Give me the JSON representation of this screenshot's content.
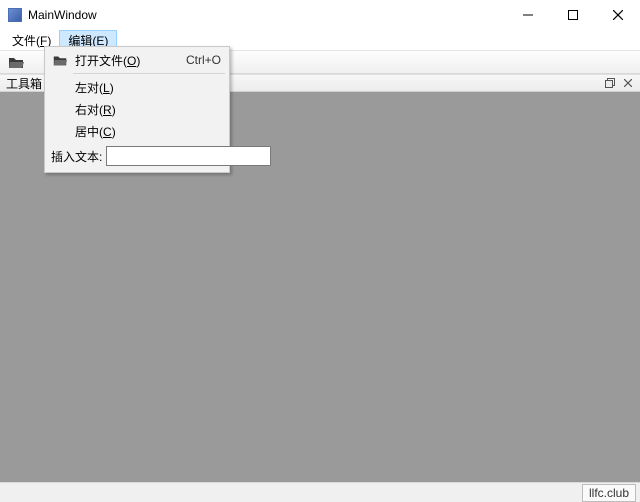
{
  "window": {
    "title": "MainWindow"
  },
  "menubar": {
    "file": {
      "label": "文件",
      "mnemonic": "F"
    },
    "edit": {
      "label": "编辑",
      "mnemonic": "E"
    }
  },
  "toolbar": {
    "icon_name": "open-file-icon"
  },
  "dock": {
    "title": "工具箱"
  },
  "popup": {
    "open": {
      "label": "打开文件",
      "mnemonic": "O",
      "shortcut": "Ctrl+O"
    },
    "left": {
      "label": "左对",
      "mnemonic": "L"
    },
    "right": {
      "label": "右对",
      "mnemonic": "R"
    },
    "center": {
      "label": "居中",
      "mnemonic": "C"
    },
    "insert_label": "插入文本:",
    "insert_value": ""
  },
  "status": {
    "text": "llfc.club"
  }
}
